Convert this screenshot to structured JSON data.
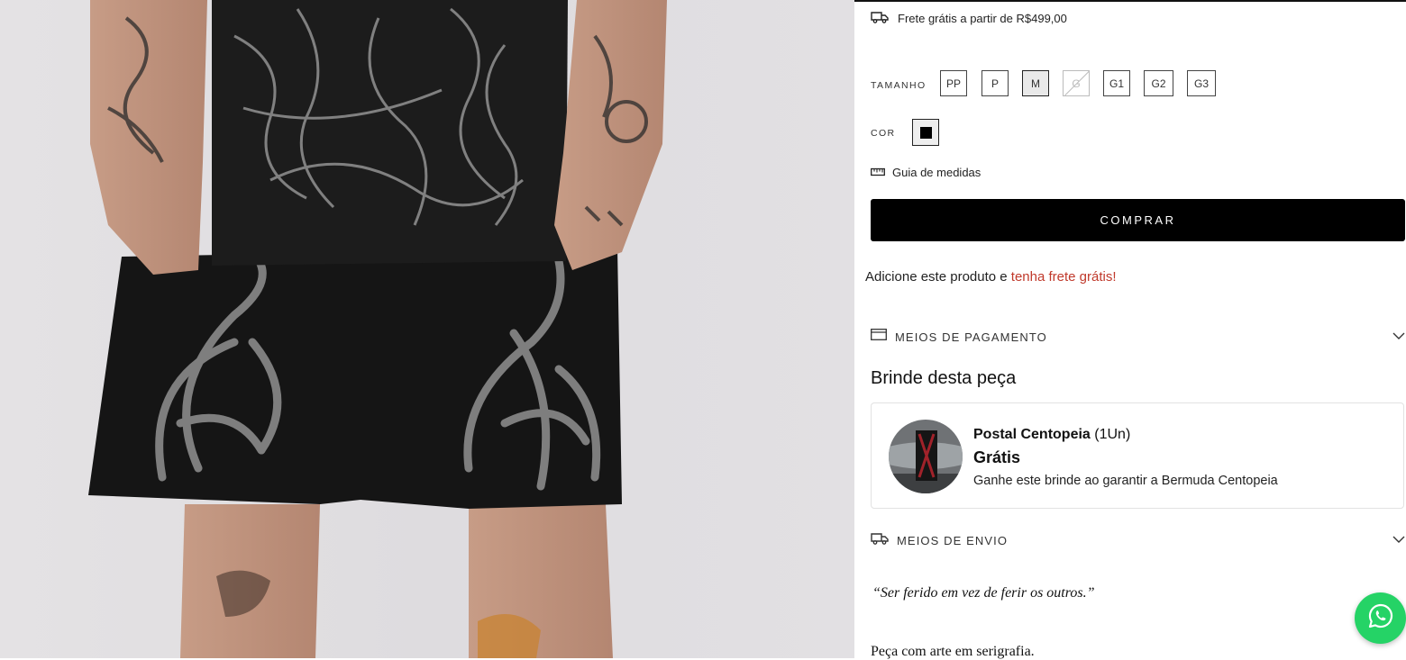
{
  "shipping_notice": {
    "text": "Frete grátis a partir de R$499,00",
    "icon": "truck-icon"
  },
  "size_selector": {
    "label": "TAMANHO",
    "options": [
      {
        "label": "PP",
        "state": "available"
      },
      {
        "label": "P",
        "state": "available"
      },
      {
        "label": "M",
        "state": "selected"
      },
      {
        "label": "G",
        "state": "unavailable"
      },
      {
        "label": "G1",
        "state": "available"
      },
      {
        "label": "G2",
        "state": "available"
      },
      {
        "label": "G3",
        "state": "available"
      }
    ]
  },
  "color_selector": {
    "label": "COR",
    "selected_color": "#000000"
  },
  "size_guide": {
    "label": "Guia de medidas",
    "icon": "ruler-icon"
  },
  "buy_button": {
    "label": "COMPRAR"
  },
  "promo": {
    "text": "Adicione este produto e ",
    "accent": "tenha frete grátis!",
    "accent_color": "#c0392b"
  },
  "accordions": {
    "payment": {
      "label": "MEIOS DE PAGAMENTO",
      "icon": "credit-card-icon"
    },
    "shipping": {
      "label": "MEIOS DE ENVIO",
      "icon": "truck-icon"
    }
  },
  "gift": {
    "heading": "Brinde desta peça",
    "name": "Postal Centopeia",
    "quantity": "(1Un)",
    "price": "Grátis",
    "description": "Ganhe este brinde ao garantir a Bermuda Centopeia"
  },
  "product_description": {
    "quote": "“Ser ferido em vez de ferir os outros.”",
    "text": "Peça com arte em serigrafia."
  },
  "whatsapp": {
    "icon": "whatsapp-icon",
    "color": "#25d366"
  }
}
